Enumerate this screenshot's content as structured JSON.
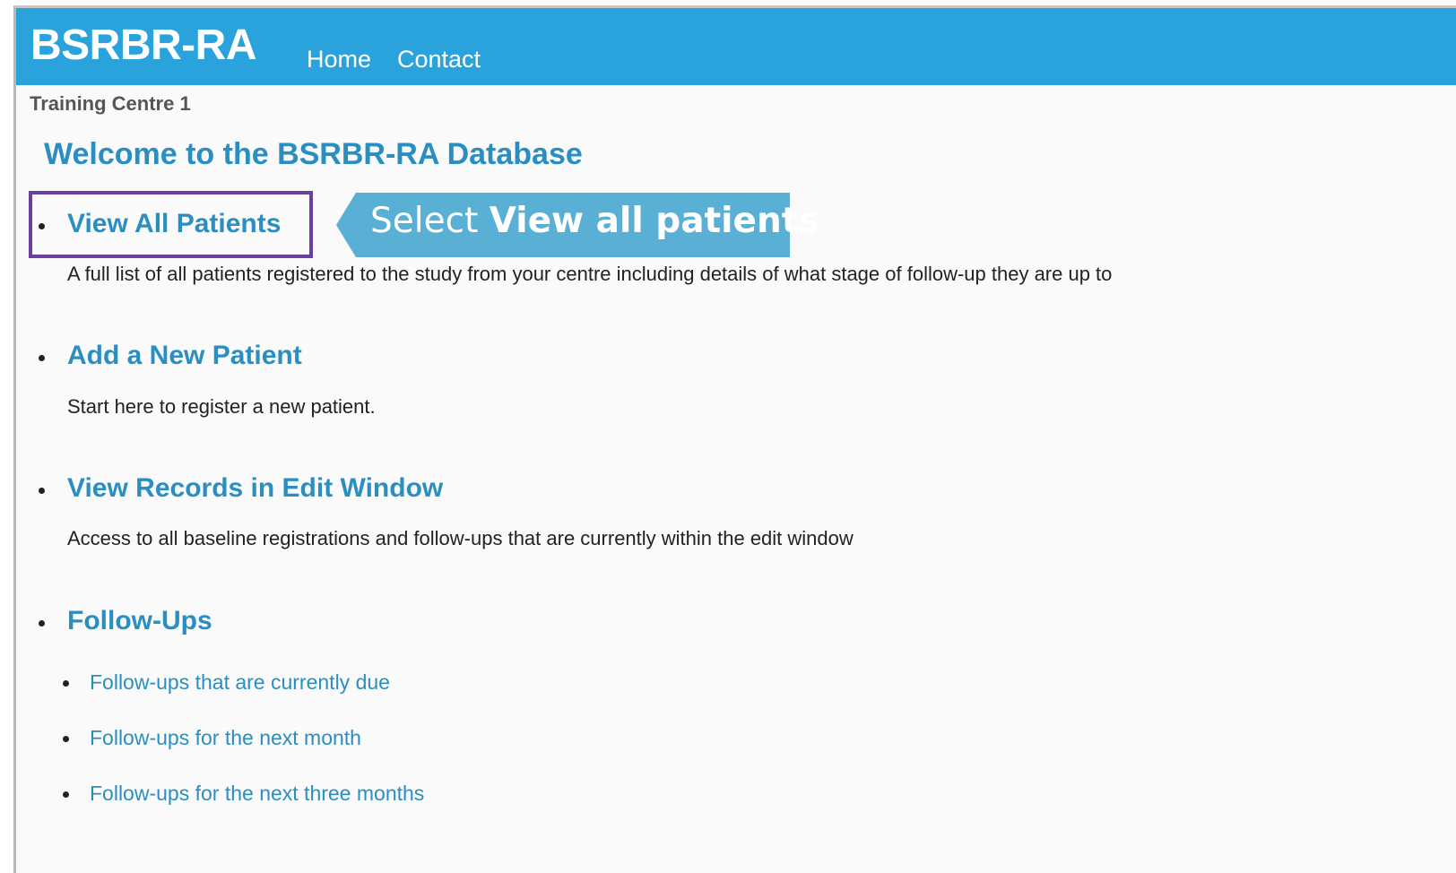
{
  "header": {
    "brand": "BSRBR-RA",
    "nav": [
      "Home",
      "Contact"
    ],
    "background_color": "#2aa3dd"
  },
  "centre_name": "Training Centre 1",
  "welcome_title": "Welcome to the BSRBR-RA Database",
  "sections": [
    {
      "title": "View All Patients",
      "description": "A full list of all patients registered to the study from your centre including details of what stage of follow-up they are up to"
    },
    {
      "title": "Add a New Patient",
      "description": "Start here to register a new patient."
    },
    {
      "title": "View Records in Edit Window",
      "description": "Access to all baseline registrations and follow-ups that are currently within the edit window"
    },
    {
      "title": "Follow-Ups",
      "links": [
        "Follow-ups that are currently due",
        "Follow-ups for the next month",
        "Follow-ups for the next three months"
      ]
    }
  ],
  "annotation": {
    "prefix": "Select ",
    "emphasis": "View all patients",
    "highlight_color": "#6a3fa0",
    "callout_color": "#5ab0d4"
  },
  "link_color": "#2a8fc0"
}
